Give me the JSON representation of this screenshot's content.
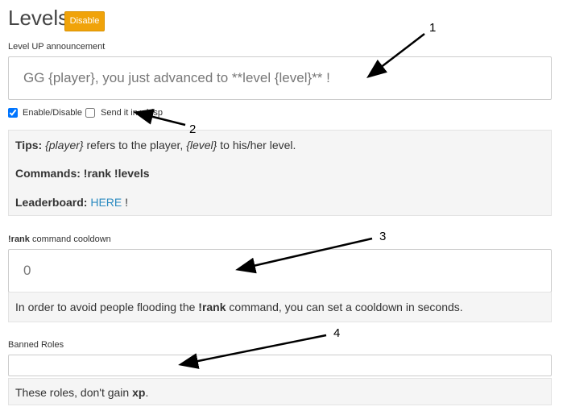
{
  "header": {
    "title": "Levels",
    "disable_label": "Disable"
  },
  "announcement": {
    "label": "Level UP announcement",
    "value": "GG {player}, you just advanced to **level {level}** !"
  },
  "options": {
    "enable_label": "Enable/Disable",
    "enable_checked": true,
    "whisp_label": "Send it in whisp",
    "whisp_checked": false
  },
  "tips": {
    "tips_label": "Tips:",
    "player_var": "{player}",
    "text1": "refers to the player,",
    "level_var": "{level}",
    "text2": "to his/her level.",
    "commands_label": "Commands:",
    "commands_value": "!rank !levels",
    "leaderboard_label": "Leaderboard:",
    "leaderboard_link": "HERE",
    "leaderboard_suffix": "!"
  },
  "cooldown": {
    "label_bold": "!rank",
    "label_rest": "command cooldown",
    "value": "0",
    "help_prefix": "In order to avoid people flooding the",
    "help_cmd": "!rank",
    "help_suffix": "command, you can set a cooldown in seconds."
  },
  "banned": {
    "label": "Banned Roles",
    "value": "",
    "help_prefix": "These roles, don't gain",
    "help_bold": "xp",
    "help_suffix": "."
  },
  "annotations": {
    "n1": "1",
    "n2": "2",
    "n3": "3",
    "n4": "4"
  }
}
